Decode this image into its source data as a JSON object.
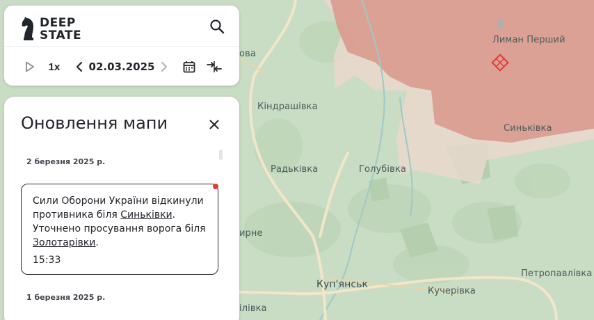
{
  "map": {
    "places": [
      {
        "id": "lyman-pershyi",
        "name": "Лиман Перший"
      },
      {
        "id": "kyndrashivka",
        "name": "Кіндрашівка"
      },
      {
        "id": "synkivka",
        "name": "Синьківка"
      },
      {
        "id": "radkivka",
        "name": "Радьківка"
      },
      {
        "id": "holubivka",
        "name": "Голубівка"
      },
      {
        "id": "kupiansk",
        "name": "Куп'янськ"
      },
      {
        "id": "kucherivka",
        "name": "Кучерівка"
      },
      {
        "id": "petropavlivka",
        "name": "Петропавлівка"
      },
      {
        "id": "partial-left-1",
        "name": "ова"
      },
      {
        "id": "partial-left-2",
        "name": "ирне"
      },
      {
        "id": "partial-left-3",
        "name": "ілівка"
      }
    ],
    "colors": {
      "terrain": "#c9dcc4",
      "occupied": "#d99a8e",
      "grey_zone": "#e9d8cc",
      "roads": "#f2e6c8",
      "rivers": "#9fc9c6"
    }
  },
  "toolbar": {
    "logo_line1": "DEEP",
    "logo_line2": "STATE",
    "speed_label": "1x",
    "date_label": "02.03.2025",
    "icons": {
      "search": "search-icon",
      "play": "play-icon",
      "prev": "chevron-left-icon",
      "next": "chevron-right-icon",
      "calendar": "calendar-icon",
      "compare": "compare-arrows-icon"
    }
  },
  "panel": {
    "title": "Оновлення мапи",
    "days": [
      {
        "label": "2 березня 2025 р.",
        "updates": [
          {
            "text_part1": "Сили Оборони України відкинули противника біля ",
            "link1": "Синьківки",
            "text_part2": ". Уточнено просування ворога біля ",
            "link2": "Золотарівки",
            "text_part3": ".",
            "time": "15:33"
          }
        ]
      },
      {
        "label": "1 березня 2025 р.",
        "updates": []
      }
    ]
  }
}
